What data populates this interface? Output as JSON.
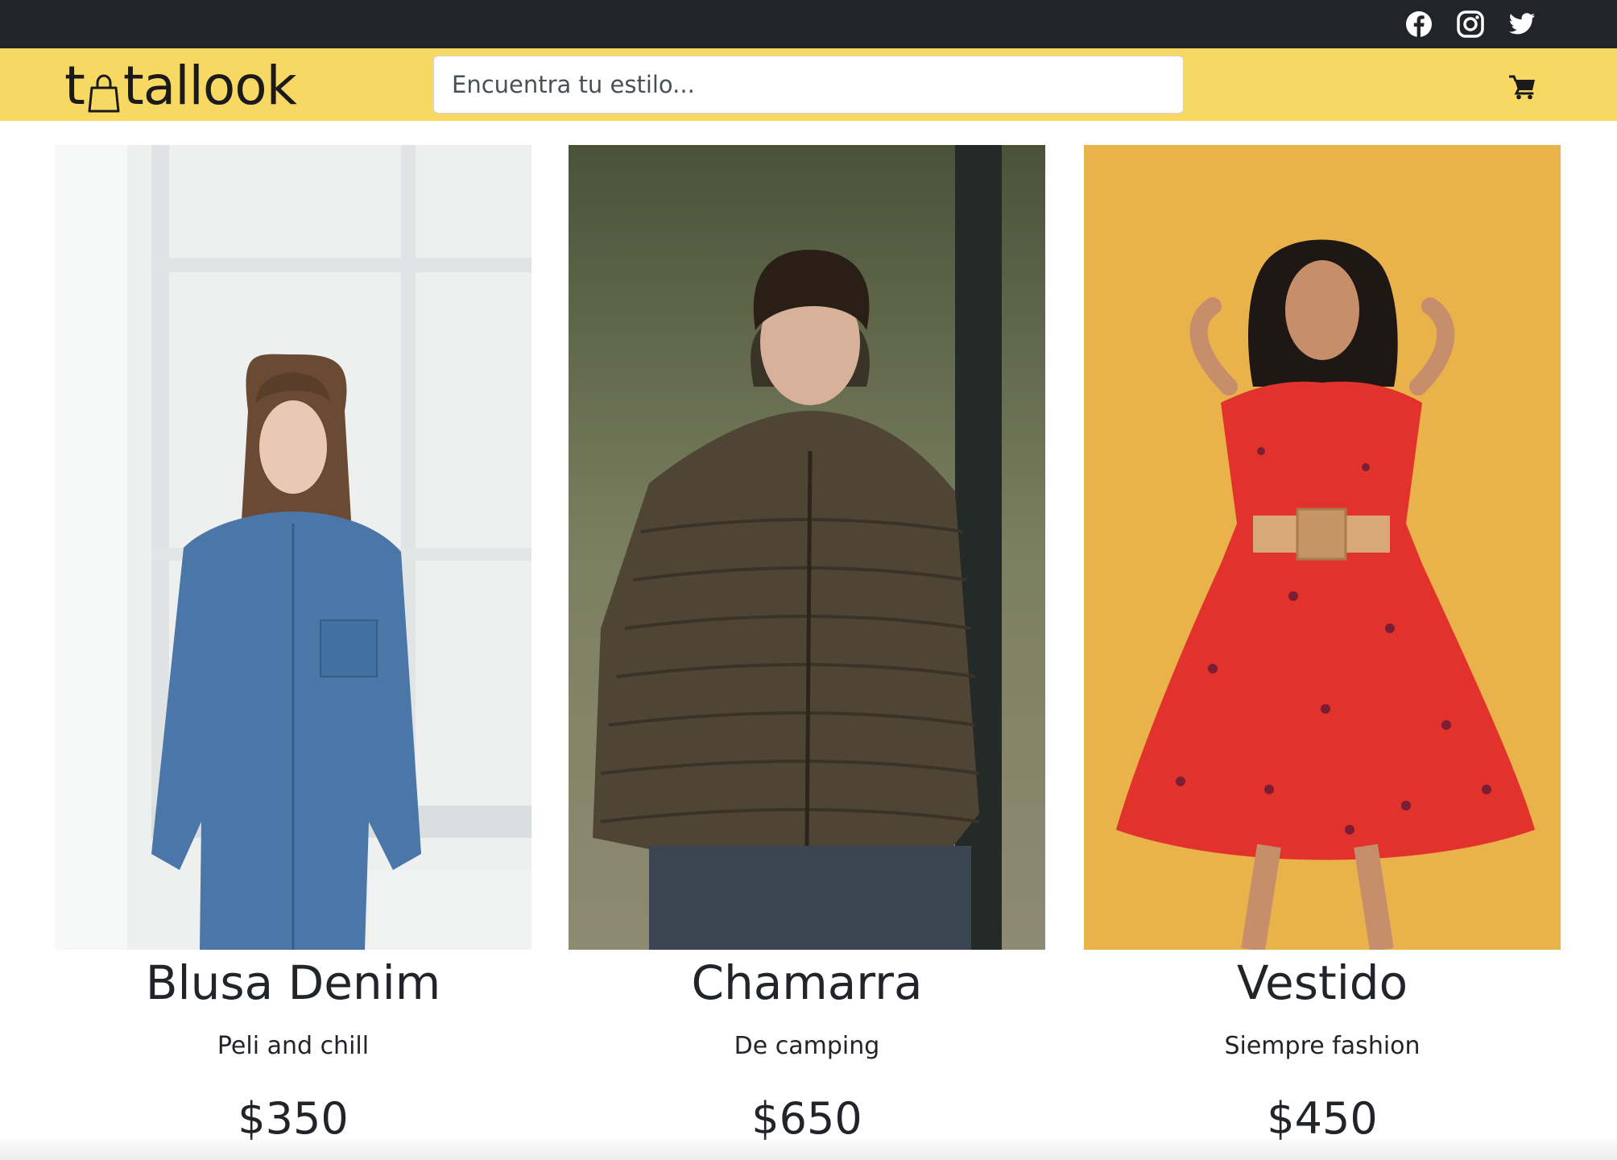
{
  "brand": {
    "name_prefix": "t",
    "name_suffix": "tallook",
    "accent": "#f7d862"
  },
  "topbar": {
    "background": "#212529",
    "social": [
      {
        "icon": "facebook-icon"
      },
      {
        "icon": "instagram-icon"
      },
      {
        "icon": "twitter-icon"
      }
    ]
  },
  "search": {
    "placeholder": "Encuentra tu estilo...",
    "value": ""
  },
  "cart": {
    "icon": "shopping-cart-icon"
  },
  "products": [
    {
      "name": "Blusa Denim",
      "tagline": "Peli and chill",
      "price": "$350"
    },
    {
      "name": "Chamarra",
      "tagline": "De camping",
      "price": "$650"
    },
    {
      "name": "Vestido",
      "tagline": "Siempre fashion",
      "price": "$450"
    }
  ]
}
